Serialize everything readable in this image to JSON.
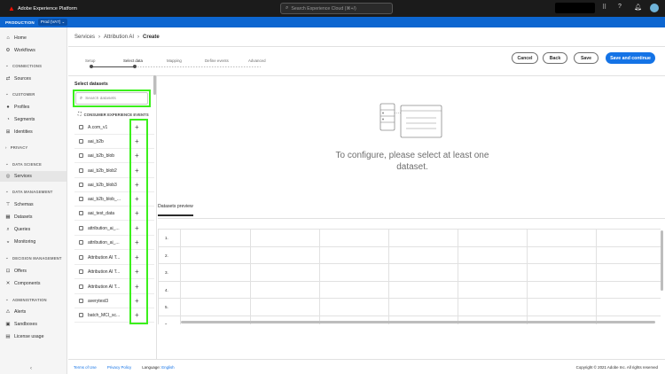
{
  "app": {
    "title": "Adobe Experience Platform",
    "search_placeholder": "Search Experience Cloud (⌘+/)"
  },
  "org": {
    "label": "PRODUCTION",
    "sandbox": "Prod (VA7)"
  },
  "nav": {
    "home": "Home",
    "workflows": "Workflows",
    "sec_connections": "CONNECTIONS",
    "sources": "Sources",
    "sec_customer": "CUSTOMER",
    "profiles": "Profiles",
    "segments": "Segments",
    "identities": "Identities",
    "sec_privacy": "PRIVACY",
    "sec_data_science": "DATA SCIENCE",
    "services": "Services",
    "sec_data_management": "DATA MANAGEMENT",
    "schemas": "Schemas",
    "datasets": "Datasets",
    "queries": "Queries",
    "monitoring": "Monitoring",
    "sec_decision_management": "DECISION MANAGEMENT",
    "offers": "Offers",
    "components": "Components",
    "sec_administration": "ADMINISTRATION",
    "alerts": "Alerts",
    "sandboxes": "Sandboxes",
    "license_usage": "License usage"
  },
  "breadcrumb": [
    "Services",
    "Attribution AI",
    "Create"
  ],
  "steps": [
    "Setup",
    "Select data",
    "Mapping",
    "Define events",
    "Advanced"
  ],
  "buttons": {
    "cancel": "Cancel",
    "back": "Back",
    "save": "Save",
    "save_continue": "Save and continue"
  },
  "datasets": {
    "title": "Select datasets",
    "search_placeholder": "Search datasets",
    "group": "CONSUMER EXPERIENCE EVENTS",
    "items": [
      "A.com_v1",
      "aai_b2b",
      "aai_b2b_blob",
      "aai_b2b_blob2",
      "aai_b2b_blob3",
      "aai_b2b_blob_...",
      "aai_test_data",
      "attribution_ai_...",
      "attribution_ai_...",
      "Attribution AI T...",
      "Attribution AI T...",
      "Attribution AI T...",
      "averytest3",
      "batch_MCI_sc..."
    ]
  },
  "empty_state": {
    "line1": "To configure, please select at least one",
    "line2": "dataset."
  },
  "preview": {
    "tab": "Datasets preview",
    "row_numbers": [
      "1.",
      "2.",
      "3.",
      "4.",
      "5.",
      "6."
    ]
  },
  "footer": {
    "terms": "Terms of Use",
    "privacy": "Privacy Policy",
    "language_label": "Language:",
    "language": "English",
    "copyright": "Copyright © 2021 Adobe Inc. All rights reserved"
  },
  "colors": {
    "accent": "#1473e6",
    "org_bar": "#0d66d0",
    "highlight": "#3bf01c",
    "topbar": "#1b1b1b"
  }
}
